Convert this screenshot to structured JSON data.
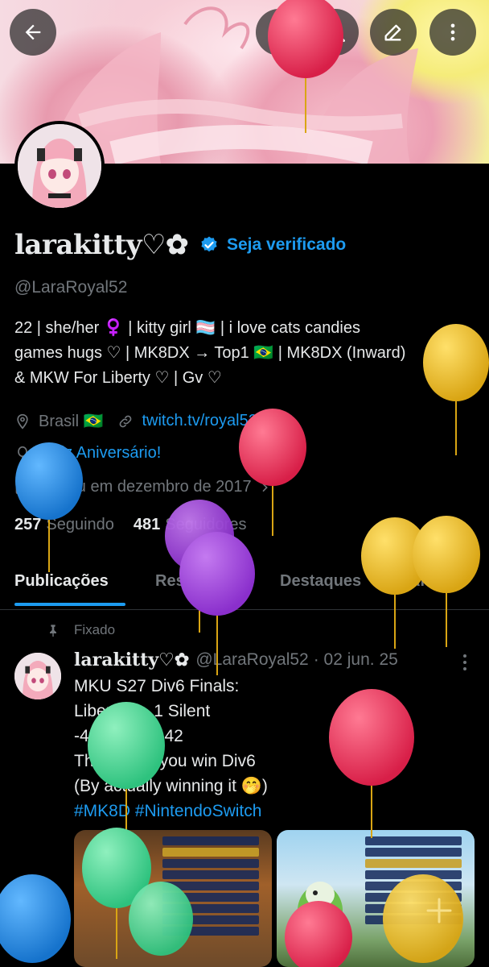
{
  "profile": {
    "display_name": "larakitty♡✿",
    "verify_cta": "Seja verificado",
    "handle": "@LaraRoyal52",
    "bio_lines": [
      "22 | she/her ♀️ | kitty girl 🏳️‍⚧️ | i love cats candies",
      "games hugs ♡ | MK8DX → Top1 🇧🇷 | MK8DX (Inward)",
      "& MKW For Liberty ♡ | Gv ♡"
    ],
    "location": "Brasil 🇧🇷",
    "website": "twitch.tv/royal52_",
    "birthday": "Feliz Aniversário!",
    "joined": "Entrou em dezembro de 2017",
    "following_count": "257",
    "following_label": "Seguindo",
    "followers_count": "481",
    "followers_label": "Seguidores"
  },
  "tabs": [
    "Publicações",
    "Respostas",
    "Destaques",
    "Artigos"
  ],
  "active_tab": "Publicações",
  "post": {
    "pinned_label": "Fixado",
    "author_name": "larakitty♡✿",
    "author_handle": "@LaraRoyal52",
    "date": "· 02 jun. 25",
    "lines": [
      "MKU S27 Div6 Finals:",
      "Liberty 2 - 1 Silent",
      "-40 | +12 | +42",
      "That's how you win Div6",
      "(By actually winning it 🤭)"
    ],
    "hashtags": "#MK8D #NintendoSwitch"
  },
  "colors": {
    "accent": "#1d9bf0",
    "muted": "#71767b",
    "background": "#000000",
    "balloon_red": "#e0294f",
    "balloon_blue": "#1f8ee0",
    "balloon_yellow": "#e8b824",
    "balloon_purple": "#9c3fd6",
    "balloon_green": "#3fd68e"
  },
  "icons": {
    "back": "arrow-left-icon",
    "search": "search-icon",
    "edit": "pencil-icon",
    "more": "more-vertical-icon",
    "location": "location-pin-icon",
    "link": "link-icon",
    "birthday": "balloon-icon",
    "joined": "calendar-icon",
    "pinned": "pin-icon",
    "compose": "plus-icon"
  }
}
